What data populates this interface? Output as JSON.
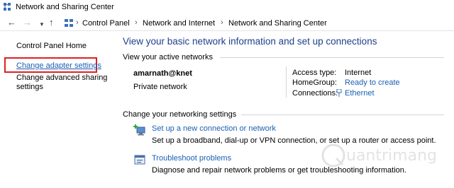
{
  "window": {
    "title": "Network and Sharing Center"
  },
  "address": {
    "back_icon": "back-arrow-icon",
    "forward_icon": "forward-arrow-icon",
    "recent_icon": "chevron-down-icon",
    "up_icon": "up-arrow-icon",
    "crumbs": [
      "Control Panel",
      "Network and Internet",
      "Network and Sharing Center"
    ]
  },
  "sidebar": {
    "home": "Control Panel Home",
    "adapter": "Change adapter settings",
    "advanced_line1": "Change advanced sharing",
    "advanced_line2": "settings"
  },
  "main": {
    "title": "View your basic network information and set up connections",
    "active_label": "View your active networks",
    "network": {
      "name": "amarnath@knet",
      "category": "Private network",
      "access_type_label": "Access type:",
      "access_type_value": "Internet",
      "homegroup_label": "HomeGroup:",
      "homegroup_value": "Ready to create",
      "connections_label": "Connections:",
      "connections_value": "Ethernet"
    },
    "settings_label": "Change your networking settings",
    "tasks": [
      {
        "link": "Set up a new connection or network",
        "desc": "Set up a broadband, dial-up or VPN connection, or set up a router or access point."
      },
      {
        "link": "Troubleshoot problems",
        "desc": "Diagnose and repair network problems or get troubleshooting information."
      }
    ]
  },
  "colors": {
    "link": "#1a5fb4",
    "title_blue": "#1e3f8a",
    "highlight": "#e02020"
  },
  "watermark": {
    "text": "uantrimang"
  }
}
